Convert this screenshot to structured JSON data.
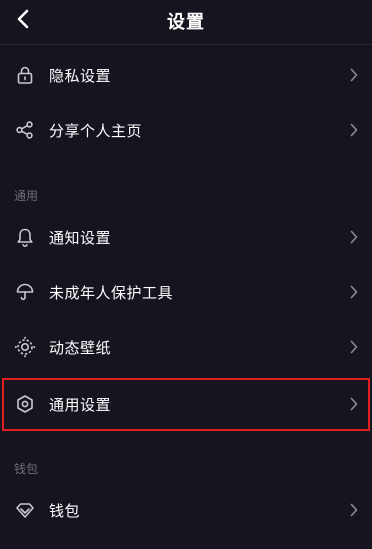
{
  "header": {
    "title": "设置",
    "back_icon": "chevron-left-icon"
  },
  "rows_top": [
    {
      "label": "隐私设置",
      "icon": "lock-icon"
    },
    {
      "label": "分享个人主页",
      "icon": "share-icon"
    }
  ],
  "section_general": {
    "title": "通用",
    "items": [
      {
        "label": "通知设置",
        "icon": "bell-icon"
      },
      {
        "label": "未成年人保护工具",
        "icon": "umbrella-icon"
      },
      {
        "label": "动态壁纸",
        "icon": "wallpaper-icon"
      },
      {
        "label": "通用设置",
        "icon": "hexagon-settings-icon",
        "highlighted": true
      }
    ]
  },
  "section_wallet": {
    "title": "钱包",
    "items": [
      {
        "label": "钱包",
        "icon": "diamond-icon"
      }
    ]
  },
  "colors": {
    "background": "#15141f",
    "text": "#ffffff",
    "muted": "#6f6e78",
    "icon": "#c9c8d0",
    "highlight_border": "#e02020"
  }
}
